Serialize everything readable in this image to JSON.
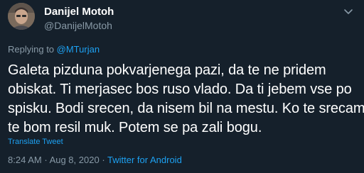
{
  "author": {
    "display_name": "Danijel Motoh",
    "handle": "@DanijelMotoh"
  },
  "replying": {
    "prefix": "Replying to",
    "mention": "@MTurjan"
  },
  "tweet": {
    "lines": [
      "Galeta pizduna pokvarjenega pazi, da te ne pridem",
      "obiskat. Ti merjasec bos ruso vlado. Da ti jebem vse po",
      "spisku. Bodi srecen, da nisem bil na mestu. Ko te srecam",
      "te bom resil muk. Potem se pa zali bogu."
    ],
    "translate_label": "Translate Tweet"
  },
  "meta": {
    "time": "8:24 AM",
    "separator": "·",
    "date": "Aug 8, 2020",
    "source": "Twitter for Android"
  },
  "icons": {
    "avatar": "profile-photo",
    "more": "chevron-down-icon"
  },
  "colors": {
    "background": "#15202b",
    "text_primary": "#ffffff",
    "text_secondary": "#8899a6",
    "accent": "#1da1f2"
  }
}
